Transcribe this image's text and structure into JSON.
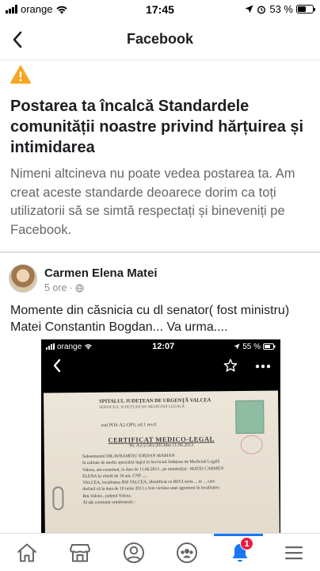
{
  "status_bar": {
    "carrier": "orange",
    "time": "17:45",
    "battery_text": "53 %",
    "battery_level": 0.53
  },
  "header": {
    "title": "Facebook",
    "back_icon": "chevron-left-icon"
  },
  "notice": {
    "icon": "warning-icon",
    "title": "Postarea ta încalcă Standardele comunității noastre privind hărțuirea și intimidarea",
    "body": "Nimeni altcineva nu poate vedea postarea ta. Am creat aceste standarde deoarece dorim ca toți utilizatorii să se simtă respectați și bineveniți pe Facebook."
  },
  "post": {
    "author": "Carmen Elena Matei",
    "time": "5 ore",
    "separator": "·",
    "privacy_icon": "globe-icon",
    "text": "Momente din căsnicia cu dl senator( fost ministru) Matei Constantin Bogdan... Va urma...."
  },
  "embedded_screenshot": {
    "carrier": "orange",
    "time": "12:07",
    "battery_text": "55 %",
    "document": {
      "hospital": "SPITALUL JUDEȚEAN DE URGENȚĂ VALCEA",
      "department": "SERVICIUL JUDEȚEAN DE MEDICINĂ LEGALĂ",
      "ref": "cod POS-A2-OPS, ed.1 rev.0",
      "title": "CERTIFICAT MEDICO-LEGAL",
      "number": "Nr. A2/2/581/2013din 11.06.2013",
      "lines": [
        "Subsemnatul DR.AVRAMOIU IORDAN MARIAN",
        "în calitate de medic specialist legist la Serviciul Județean de Medicină Legală",
        "Valcea, am examinat, la data de 11.06.2013 , pe numitul(a) : MATEI CARMEN",
        "ELENA în vârstă de 34 ani, CNP ..., ",
        "VALCEA, localitatea RM VALCEA, identificat cu BI/CI seria ... nr ... care",
        "declară că la data de 10 iunie 2013 a fost victima unei agresiuni în localitatea",
        "Rm.Valcea , județul Valcea.",
        "Al șăs constatat următoarele :"
      ]
    }
  },
  "tabs": [
    {
      "name": "home",
      "icon": "home-icon"
    },
    {
      "name": "marketplace",
      "icon": "marketplace-icon"
    },
    {
      "name": "profile",
      "icon": "profile-icon"
    },
    {
      "name": "groups",
      "icon": "groups-icon"
    },
    {
      "name": "notifications",
      "icon": "bell-icon",
      "badge": "1",
      "active": true
    },
    {
      "name": "menu",
      "icon": "menu-icon"
    }
  ],
  "colors": {
    "accent": "#1877f2",
    "warning": "#f5a623",
    "badge": "#e41e3f",
    "secondary_text": "#65676b"
  }
}
